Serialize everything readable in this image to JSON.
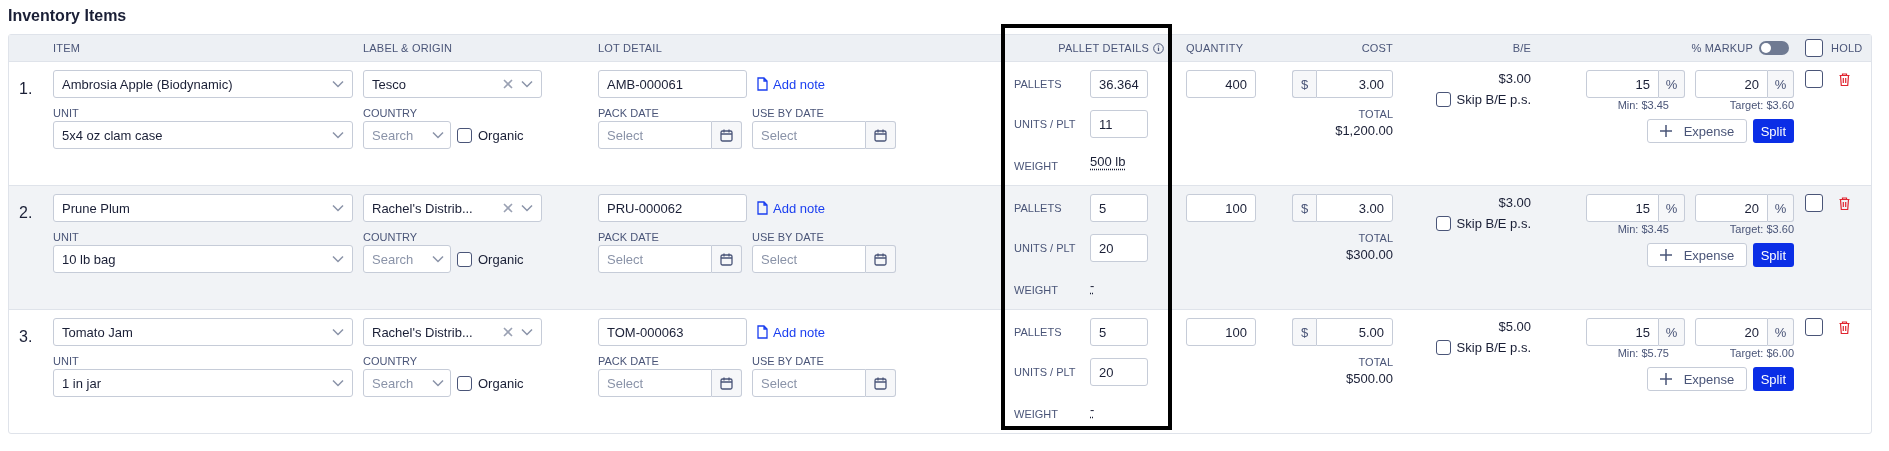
{
  "title": "Inventory Items",
  "header": {
    "item": "ITEM",
    "label_origin": "LABEL & ORIGIN",
    "lot_detail": "LOT DETAIL",
    "pallet_details": "PALLET DETAILS",
    "quantity": "QUANTITY",
    "cost": "COST",
    "break_even": "B/E",
    "markup": "% MARKUP",
    "markup_toggle_on": false,
    "hold": "HOLD",
    "hold_all_checked": false
  },
  "rows": [
    {
      "number": "1.",
      "highlighted": false,
      "item": "Ambrosia Apple (Biodynamic)",
      "unit_label": "UNIT",
      "unit": "5x4 oz clam case",
      "label": "Tesco",
      "country_label": "COUNTRY",
      "country_placeholder": "Search",
      "organic_label": "Organic",
      "organic_checked": false,
      "lot": "AMB-000061",
      "add_note": "Add note",
      "pack_date_label": "PACK DATE",
      "pack_date_placeholder": "Select",
      "use_by_label": "USE BY DATE",
      "use_by_placeholder": "Select",
      "pallets_label": "PALLETS",
      "pallets": "36.364",
      "units_label": "UNITS / PLT",
      "units_per_pallet": "11",
      "weight_label": "WEIGHT",
      "weight": "500 lb",
      "quantity": "400",
      "currency": "$",
      "cost": "3.00",
      "total_label": "TOTAL",
      "total": "$1,200.00",
      "break_even": "$3.00",
      "skip_label": "Skip B/E p.s.",
      "skip_checked": false,
      "min_markup": "15",
      "min_unit": "%",
      "min_price": "Min: $3.45",
      "target_markup": "20",
      "target_unit": "%",
      "target_price": "Target: $3.60",
      "expense": "Expense",
      "split": "Split",
      "hold_checked": false
    },
    {
      "number": "2.",
      "highlighted": true,
      "item": "Prune Plum",
      "unit_label": "UNIT",
      "unit": "10 lb bag",
      "label": "Rachel's Distrib...",
      "country_label": "COUNTRY",
      "country_placeholder": "Search",
      "organic_label": "Organic",
      "organic_checked": false,
      "lot": "PRU-000062",
      "add_note": "Add note",
      "pack_date_label": "PACK DATE",
      "pack_date_placeholder": "Select",
      "use_by_label": "USE BY DATE",
      "use_by_placeholder": "Select",
      "pallets_label": "PALLETS",
      "pallets": "5",
      "units_label": "UNITS / PLT",
      "units_per_pallet": "20",
      "weight_label": "WEIGHT",
      "weight": "-",
      "quantity": "100",
      "currency": "$",
      "cost": "3.00",
      "total_label": "TOTAL",
      "total": "$300.00",
      "break_even": "$3.00",
      "skip_label": "Skip B/E p.s.",
      "skip_checked": false,
      "min_markup": "15",
      "min_unit": "%",
      "min_price": "Min: $3.45",
      "target_markup": "20",
      "target_unit": "%",
      "target_price": "Target: $3.60",
      "expense": "Expense",
      "split": "Split",
      "hold_checked": false
    },
    {
      "number": "3.",
      "highlighted": false,
      "item": "Tomato Jam",
      "unit_label": "UNIT",
      "unit": "1 in jar",
      "label": "Rachel's Distrib...",
      "country_label": "COUNTRY",
      "country_placeholder": "Search",
      "organic_label": "Organic",
      "organic_checked": false,
      "lot": "TOM-000063",
      "add_note": "Add note",
      "pack_date_label": "PACK DATE",
      "pack_date_placeholder": "Select",
      "use_by_label": "USE BY DATE",
      "use_by_placeholder": "Select",
      "pallets_label": "PALLETS",
      "pallets": "5",
      "units_label": "UNITS / PLT",
      "units_per_pallet": "20",
      "weight_label": "WEIGHT",
      "weight": "-",
      "quantity": "100",
      "currency": "$",
      "cost": "5.00",
      "total_label": "TOTAL",
      "total": "$500.00",
      "break_even": "$5.00",
      "skip_label": "Skip B/E p.s.",
      "skip_checked": false,
      "min_markup": "15",
      "min_unit": "%",
      "min_price": "Min: $5.75",
      "target_markup": "20",
      "target_unit": "%",
      "target_price": "Target: $6.00",
      "expense": "Expense",
      "split": "Split",
      "hold_checked": false
    }
  ]
}
